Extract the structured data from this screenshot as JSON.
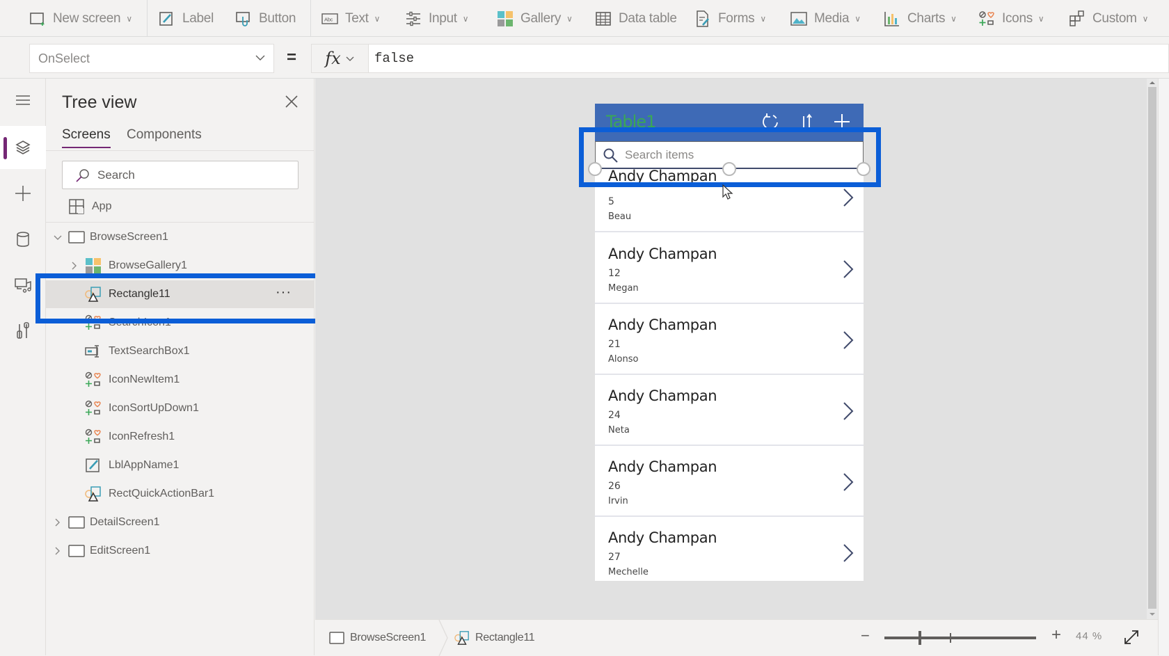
{
  "ribbon": {
    "items": [
      {
        "label": "New screen",
        "icon": "new-screen-icon",
        "has_dropdown": true
      },
      {
        "label": "Label",
        "icon": "label-icon",
        "has_dropdown": false
      },
      {
        "label": "Button",
        "icon": "button-icon",
        "has_dropdown": false
      },
      {
        "label": "Text",
        "icon": "text-icon",
        "has_dropdown": true
      },
      {
        "label": "Input",
        "icon": "input-icon",
        "has_dropdown": true
      },
      {
        "label": "Gallery",
        "icon": "gallery-icon",
        "has_dropdown": true
      },
      {
        "label": "Data table",
        "icon": "data-table-icon",
        "has_dropdown": false
      },
      {
        "label": "Forms",
        "icon": "forms-icon",
        "has_dropdown": true
      },
      {
        "label": "Media",
        "icon": "media-icon",
        "has_dropdown": true
      },
      {
        "label": "Charts",
        "icon": "charts-icon",
        "has_dropdown": true
      },
      {
        "label": "Icons",
        "icon": "icons-icon",
        "has_dropdown": true
      },
      {
        "label": "Custom",
        "icon": "custom-icon",
        "has_dropdown": true
      }
    ]
  },
  "formula_bar": {
    "property": "OnSelect",
    "equals": "=",
    "fx_label": "fx",
    "formula": "false"
  },
  "rail": {
    "items": [
      {
        "name": "menu",
        "icon": "hamburger-icon",
        "active": false
      },
      {
        "name": "tree-view",
        "icon": "layers-icon",
        "active": true
      },
      {
        "name": "insert",
        "icon": "plus-icon",
        "active": false
      },
      {
        "name": "data",
        "icon": "database-icon",
        "active": false
      },
      {
        "name": "media",
        "icon": "media-icon",
        "active": false
      },
      {
        "name": "advanced-tools",
        "icon": "tools-icon",
        "active": false
      }
    ]
  },
  "tree": {
    "title": "Tree view",
    "tabs": [
      {
        "label": "Screens",
        "active": true
      },
      {
        "label": "Components",
        "active": false
      }
    ],
    "search_placeholder": "Search",
    "app_label": "App",
    "nodes": [
      {
        "label": "BrowseScreen1",
        "type": "screen",
        "level": 0,
        "expanded": true
      },
      {
        "label": "BrowseGallery1",
        "type": "gallery",
        "level": 1,
        "expanded": false
      },
      {
        "label": "Rectangle11",
        "type": "rectangle",
        "level": 1,
        "selected": true
      },
      {
        "label": "SearchIcon1",
        "type": "icon",
        "level": 1
      },
      {
        "label": "TextSearchBox1",
        "type": "textinput",
        "level": 1
      },
      {
        "label": "IconNewItem1",
        "type": "icon",
        "level": 1
      },
      {
        "label": "IconSortUpDown1",
        "type": "icon",
        "level": 1
      },
      {
        "label": "IconRefresh1",
        "type": "icon",
        "level": 1
      },
      {
        "label": "LblAppName1",
        "type": "label",
        "level": 1
      },
      {
        "label": "RectQuickActionBar1",
        "type": "rectangle",
        "level": 1
      },
      {
        "label": "DetailScreen1",
        "type": "screen",
        "level": 0,
        "expanded": false
      },
      {
        "label": "EditScreen1",
        "type": "screen",
        "level": 0,
        "expanded": false
      }
    ],
    "more_label": "···"
  },
  "app_preview": {
    "title": "Table1",
    "search_placeholder": "Search items",
    "colors": {
      "header": "#3e6ab6",
      "title": "#3aa757",
      "highlight": "#0b5ed7"
    },
    "items": [
      {
        "name": "Andy Champan",
        "number": "5",
        "sub": "Beau"
      },
      {
        "name": "Andy Champan",
        "number": "12",
        "sub": "Megan"
      },
      {
        "name": "Andy Champan",
        "number": "21",
        "sub": "Alonso"
      },
      {
        "name": "Andy Champan",
        "number": "24",
        "sub": "Neta"
      },
      {
        "name": "Andy Champan",
        "number": "26",
        "sub": "Irvin"
      },
      {
        "name": "Andy Champan",
        "number": "27",
        "sub": "Mechelle"
      }
    ]
  },
  "statusbar": {
    "breadcrumb": [
      {
        "label": "BrowseScreen1",
        "icon": "screen-icon"
      },
      {
        "label": "Rectangle11",
        "icon": "rectangle-icon"
      }
    ],
    "zoom_minus": "−",
    "zoom_plus": "+",
    "zoom_percent": "44 %",
    "zoom_value": 44
  }
}
